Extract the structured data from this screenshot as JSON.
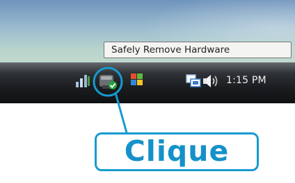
{
  "tooltip": {
    "text": "Safely Remove Hardware"
  },
  "taskbar": {
    "clock": "1:15 PM",
    "tray_icons": [
      "network-icon",
      "safely-remove-hardware-icon",
      "flag-icon",
      "display-icon",
      "speaker-icon"
    ]
  },
  "callout": {
    "label": "Clique"
  },
  "colors": {
    "callout_blue": "#169bd0",
    "taskbar_dark": "#1b1d20",
    "tooltip_bg": "#f4f4f2"
  }
}
